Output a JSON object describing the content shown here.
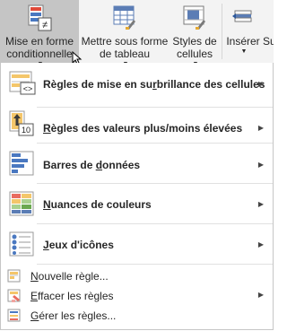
{
  "ribbon": {
    "conditional_formatting": {
      "line1": "Mise en forme",
      "line2": "conditionnelle",
      "icon": "conditional-formatting-icon"
    },
    "format_as_table": {
      "line1": "Mettre sous forme",
      "line2": "de tableau",
      "icon": "format-as-table-icon"
    },
    "cell_styles": {
      "line1": "Styles de",
      "line2": "cellules",
      "icon": "cell-styles-icon"
    },
    "insert": {
      "line1": "Insérer",
      "icon": "insert-cells-icon"
    },
    "delete_partial": {
      "line1": "Su"
    }
  },
  "menu": {
    "items": [
      {
        "label_pre": "Règles de mise en su",
        "label_u": "r",
        "label_post": "brillance des cellules",
        "icon": "highlight-cells-rules-icon"
      },
      {
        "label_pre": "",
        "label_u": "R",
        "label_post": "ègles des valeurs plus/moins élevées",
        "icon": "top-bottom-rules-icon",
        "icon_number": "10"
      },
      {
        "label_pre": "Barres de ",
        "label_u": "d",
        "label_post": "onnées",
        "icon": "data-bars-icon"
      },
      {
        "label_pre": "",
        "label_u": "N",
        "label_post": "uances de couleurs",
        "icon": "color-scales-icon"
      },
      {
        "label_pre": "",
        "label_u": "J",
        "label_post": "eux d'icônes",
        "icon": "icon-sets-icon"
      }
    ],
    "small_items": [
      {
        "label_pre": "",
        "label_u": "N",
        "label_post": "ouvelle règle...",
        "icon": "new-rule-icon",
        "submenu": false
      },
      {
        "label_pre": "",
        "label_u": "E",
        "label_post": "ffacer les règles",
        "icon": "clear-rules-icon",
        "submenu": true
      },
      {
        "label_pre": "",
        "label_u": "G",
        "label_post": "érer les règles...",
        "icon": "manage-rules-icon",
        "submenu": false
      }
    ]
  },
  "colors": {
    "ribbon_bg": "#f3f3f3",
    "active_button": "#c5c5c5",
    "excel_blue": "#2b579a",
    "data_bar_orange": "#f4a83a"
  }
}
